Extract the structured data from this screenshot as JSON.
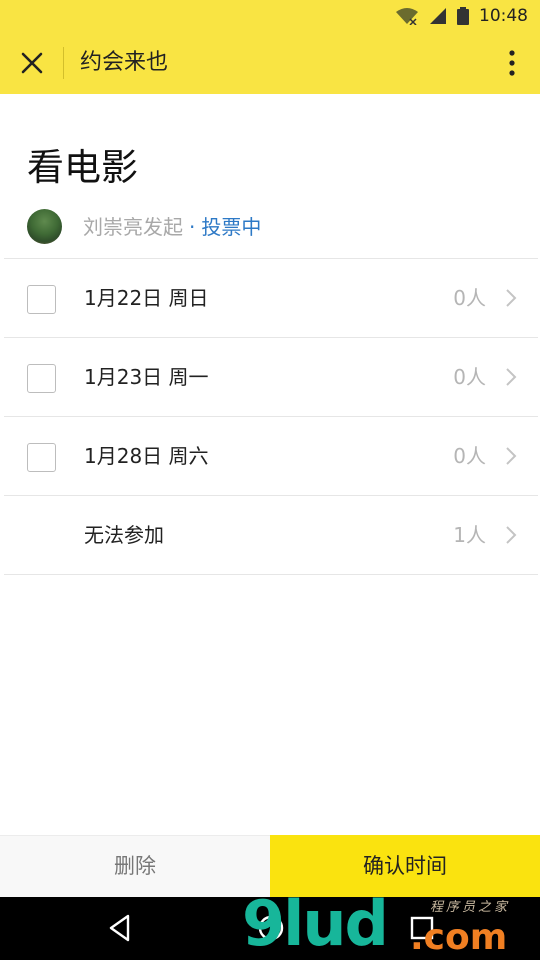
{
  "status_bar": {
    "time": "10:48",
    "icons": [
      "wifi-icon",
      "signal-icon",
      "battery-icon"
    ]
  },
  "app_bar": {
    "title": "约会来也",
    "close_icon": "close-icon",
    "more_icon": "more-vertical-icon",
    "background": "#f9e443"
  },
  "event": {
    "title": "看电影",
    "organizer": "刘崇亮发起",
    "separator": "·",
    "status": "投票中",
    "status_color": "#2d79c6"
  },
  "options": [
    {
      "label": "1月22日 周日",
      "count": "0人",
      "has_checkbox": true
    },
    {
      "label": "1月23日 周一",
      "count": "0人",
      "has_checkbox": true
    },
    {
      "label": "1月28日 周六",
      "count": "0人",
      "has_checkbox": true
    },
    {
      "label": "无法参加",
      "count": "1人",
      "has_checkbox": false
    }
  ],
  "actions": {
    "delete_label": "删除",
    "confirm_label": "确认时间",
    "confirm_color": "#fae30f"
  },
  "nav_bar": {
    "icons": [
      "back-icon",
      "home-icon",
      "recent-apps-icon"
    ]
  },
  "watermark": {
    "main": "9lud",
    "suffix": ".com",
    "sub": "程序员之家"
  }
}
